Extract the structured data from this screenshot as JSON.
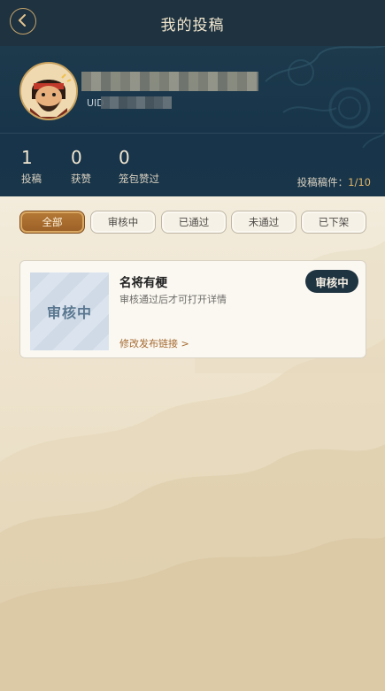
{
  "header": {
    "title": "我的投稿",
    "back_icon": "chevron-left-icon"
  },
  "profile": {
    "avatar_icon": "avatar-character-icon",
    "uid_label": "UID"
  },
  "stats": [
    {
      "value": "1",
      "label": "投稿"
    },
    {
      "value": "0",
      "label": "获赞"
    },
    {
      "value": "0",
      "label": "笼包赞过"
    }
  ],
  "quota": {
    "label": "投稿稿件：",
    "value": "1/10"
  },
  "tabs": [
    {
      "label": "全部",
      "active": true
    },
    {
      "label": "审核中",
      "active": false
    },
    {
      "label": "已通过",
      "active": false
    },
    {
      "label": "未通过",
      "active": false
    },
    {
      "label": "已下架",
      "active": false
    }
  ],
  "submission": {
    "thumb_label": "审核中",
    "title": "名将有梗",
    "description": "审核通过后才可打开详情",
    "link": "修改发布链接 >",
    "status": "审核中"
  },
  "colors": {
    "header_bg": "#1e3240",
    "profile_bg": "#17344a",
    "accent_gold": "#c9a15c",
    "tab_active": "#a8692c",
    "badge_bg": "#1f3441"
  }
}
